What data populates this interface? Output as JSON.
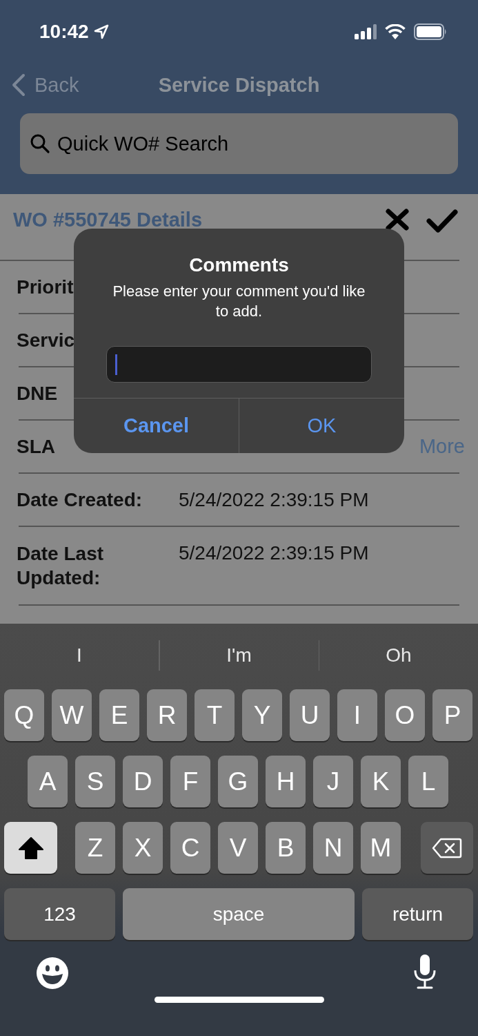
{
  "status_bar": {
    "time": "10:42"
  },
  "nav": {
    "back": "Back",
    "title": "Service Dispatch"
  },
  "search": {
    "placeholder": "Quick WO# Search"
  },
  "details": {
    "title": "WO #550745 Details",
    "rows": [
      {
        "label": "Priorit"
      },
      {
        "label": "Servic"
      },
      {
        "label": "DNE"
      },
      {
        "label": "SLA",
        "link": "More"
      },
      {
        "label": "Date Created:",
        "value": "5/24/2022 2:39:15 PM"
      },
      {
        "label": "Date Last Updated:",
        "value": "5/24/2022 2:39:15 PM"
      }
    ]
  },
  "dialog": {
    "title": "Comments",
    "message": "Please enter your comment you'd like to add.",
    "buttons": [
      {
        "label": "Cancel",
        "kind": "cancel"
      },
      {
        "label": "OK",
        "kind": "default"
      }
    ]
  },
  "keyboard": {
    "suggestions": [
      "I",
      "I'm",
      "Oh"
    ],
    "rows": [
      [
        "Q",
        "W",
        "E",
        "R",
        "T",
        "Y",
        "U",
        "I",
        "O",
        "P"
      ],
      [
        "A",
        "S",
        "D",
        "F",
        "G",
        "H",
        "J",
        "K",
        "L"
      ],
      [
        "Z",
        "X",
        "C",
        "V",
        "B",
        "N",
        "M"
      ]
    ],
    "shift": {
      "on": true
    },
    "number_key": "123",
    "space_key": "space",
    "return_key": "return"
  }
}
